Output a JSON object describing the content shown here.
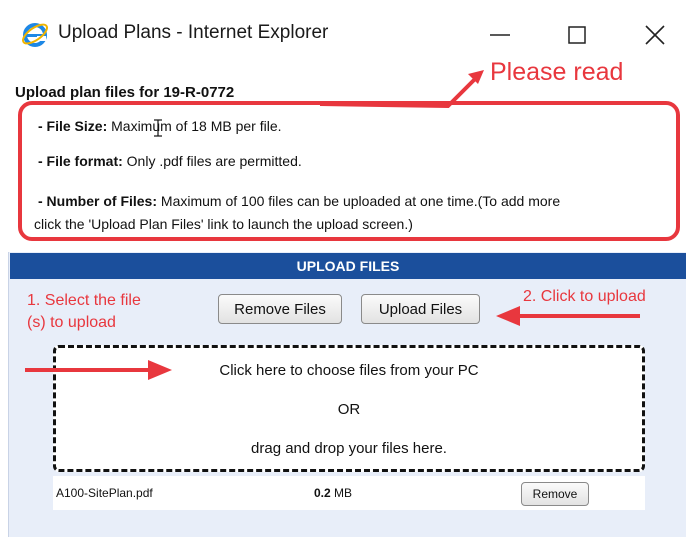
{
  "window": {
    "title": "Upload Plans - Internet Explorer",
    "icon": "internet-explorer-icon",
    "controls": [
      "minimize-icon",
      "maximize-icon",
      "close-icon"
    ]
  },
  "page": {
    "heading": "Upload plan files for 19-R-0772",
    "info": {
      "file_size_label": "- File Size:",
      "file_size_text": " Maximum of 18 MB per file.",
      "file_format_label": "- File format:",
      "file_format_text": " Only .pdf files are permitted.",
      "num_files_label": "- Number of Files:",
      "num_files_text": " Maximum of 100 files can be uploaded at one time.(To add more",
      "num_files_text_cont": "click the 'Upload Plan Files' link to launch the upload screen.)"
    }
  },
  "upload": {
    "header": "UPLOAD FILES",
    "remove_files_label": "Remove Files",
    "upload_files_label": "Upload Files",
    "dropzone": {
      "line1": "Click here to choose files from your PC",
      "line2": "OR",
      "line3": "drag and drop your files here."
    },
    "files": [
      {
        "name": "A100-SitePlan.pdf",
        "size_value": "0.2",
        "size_unit": " MB",
        "remove_label": "Remove"
      }
    ]
  },
  "annotations": {
    "please_read": "Please read",
    "step1_line1": "1. Select the file",
    "step1_line2": "(s) to upload",
    "step2": "2. Click to upload",
    "color": "#e8373e"
  },
  "colors": {
    "header_bg": "#1b4f9c",
    "panel_bg": "#e8eef9",
    "ie_blue": "#1e88e5"
  }
}
